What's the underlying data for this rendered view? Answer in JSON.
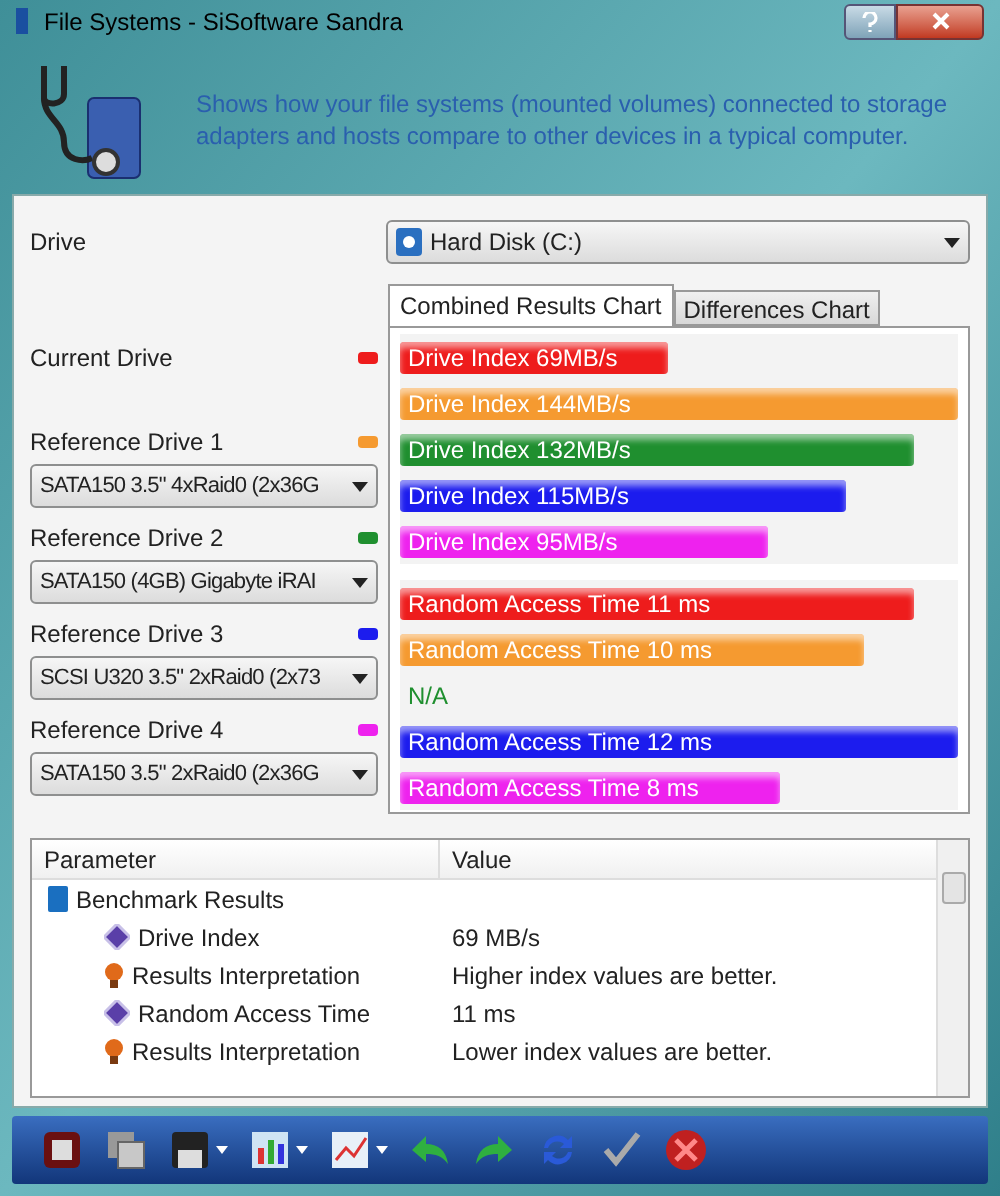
{
  "window": {
    "title": "File Systems - SiSoftware Sandra",
    "description": "Shows how your file systems (mounted volumes) connected to storage adapters and hosts compare to other devices in a typical computer."
  },
  "drive": {
    "label": "Drive",
    "value": "Hard Disk (C:)"
  },
  "current_drive": {
    "label": "Current Drive",
    "color": "#ee1c1c"
  },
  "reference_drives": [
    {
      "label": "Reference Drive 1",
      "color": "#f59a30",
      "value": "SATA150 3.5\" 4xRaid0 (2x36G"
    },
    {
      "label": "Reference Drive 2",
      "color": "#1f8f2f",
      "value": "SATA150 (4GB) Gigabyte iRAI"
    },
    {
      "label": "Reference Drive 3",
      "color": "#1c1cee",
      "value": "SCSI U320 3.5\" 2xRaid0 (2x73"
    },
    {
      "label": "Reference Drive 4",
      "color": "#ee22ee",
      "value": "SATA150 3.5\" 2xRaid0 (2x36G"
    }
  ],
  "tabs": [
    {
      "label": "Combined Results Chart",
      "selected": true
    },
    {
      "label": "Differences Chart",
      "selected": false
    }
  ],
  "bar_groups": [
    [
      {
        "kind": "bar",
        "label": "Drive Index 69MB/s",
        "color": "#ee1c1c",
        "level": 0.48
      },
      {
        "kind": "bar",
        "label": "Drive Index 144MB/s",
        "color": "#f59a30",
        "level": 1.0
      },
      {
        "kind": "bar",
        "label": "Drive Index 132MB/s",
        "color": "#1f8f2f",
        "level": 0.92
      },
      {
        "kind": "bar",
        "label": "Drive Index 115MB/s",
        "color": "#1c1cee",
        "level": 0.8
      },
      {
        "kind": "bar",
        "label": "Drive Index 95MB/s",
        "color": "#ee22ee",
        "level": 0.66
      }
    ],
    [
      {
        "kind": "bar",
        "label": "Random Access Time 11 ms",
        "color": "#ee1c1c",
        "level": 0.92
      },
      {
        "kind": "bar",
        "label": "Random Access Time 10 ms",
        "color": "#f59a30",
        "level": 0.83
      },
      {
        "kind": "text",
        "label": "N/A",
        "color": "#1f8f2f"
      },
      {
        "kind": "bar",
        "label": "Random Access Time 12 ms",
        "color": "#1c1cee",
        "level": 1.0
      },
      {
        "kind": "bar",
        "label": "Random Access Time 8 ms",
        "color": "#ee22ee",
        "level": 0.68
      }
    ]
  ],
  "table": {
    "columns": [
      "Parameter",
      "Value"
    ],
    "rows": [
      {
        "kind": "folder",
        "parameter": "Benchmark Results",
        "children": [
          {
            "kind": "diamond",
            "parameter": "Drive Index",
            "value": "69 MB/s"
          },
          {
            "kind": "bulb",
            "parameter": "Results Interpretation",
            "value": "Higher index values are better."
          },
          {
            "kind": "diamond",
            "parameter": "Random Access Time",
            "value": "11 ms"
          },
          {
            "kind": "bulb",
            "parameter": "Results Interpretation",
            "value": "Lower index values are better."
          }
        ]
      }
    ]
  }
}
